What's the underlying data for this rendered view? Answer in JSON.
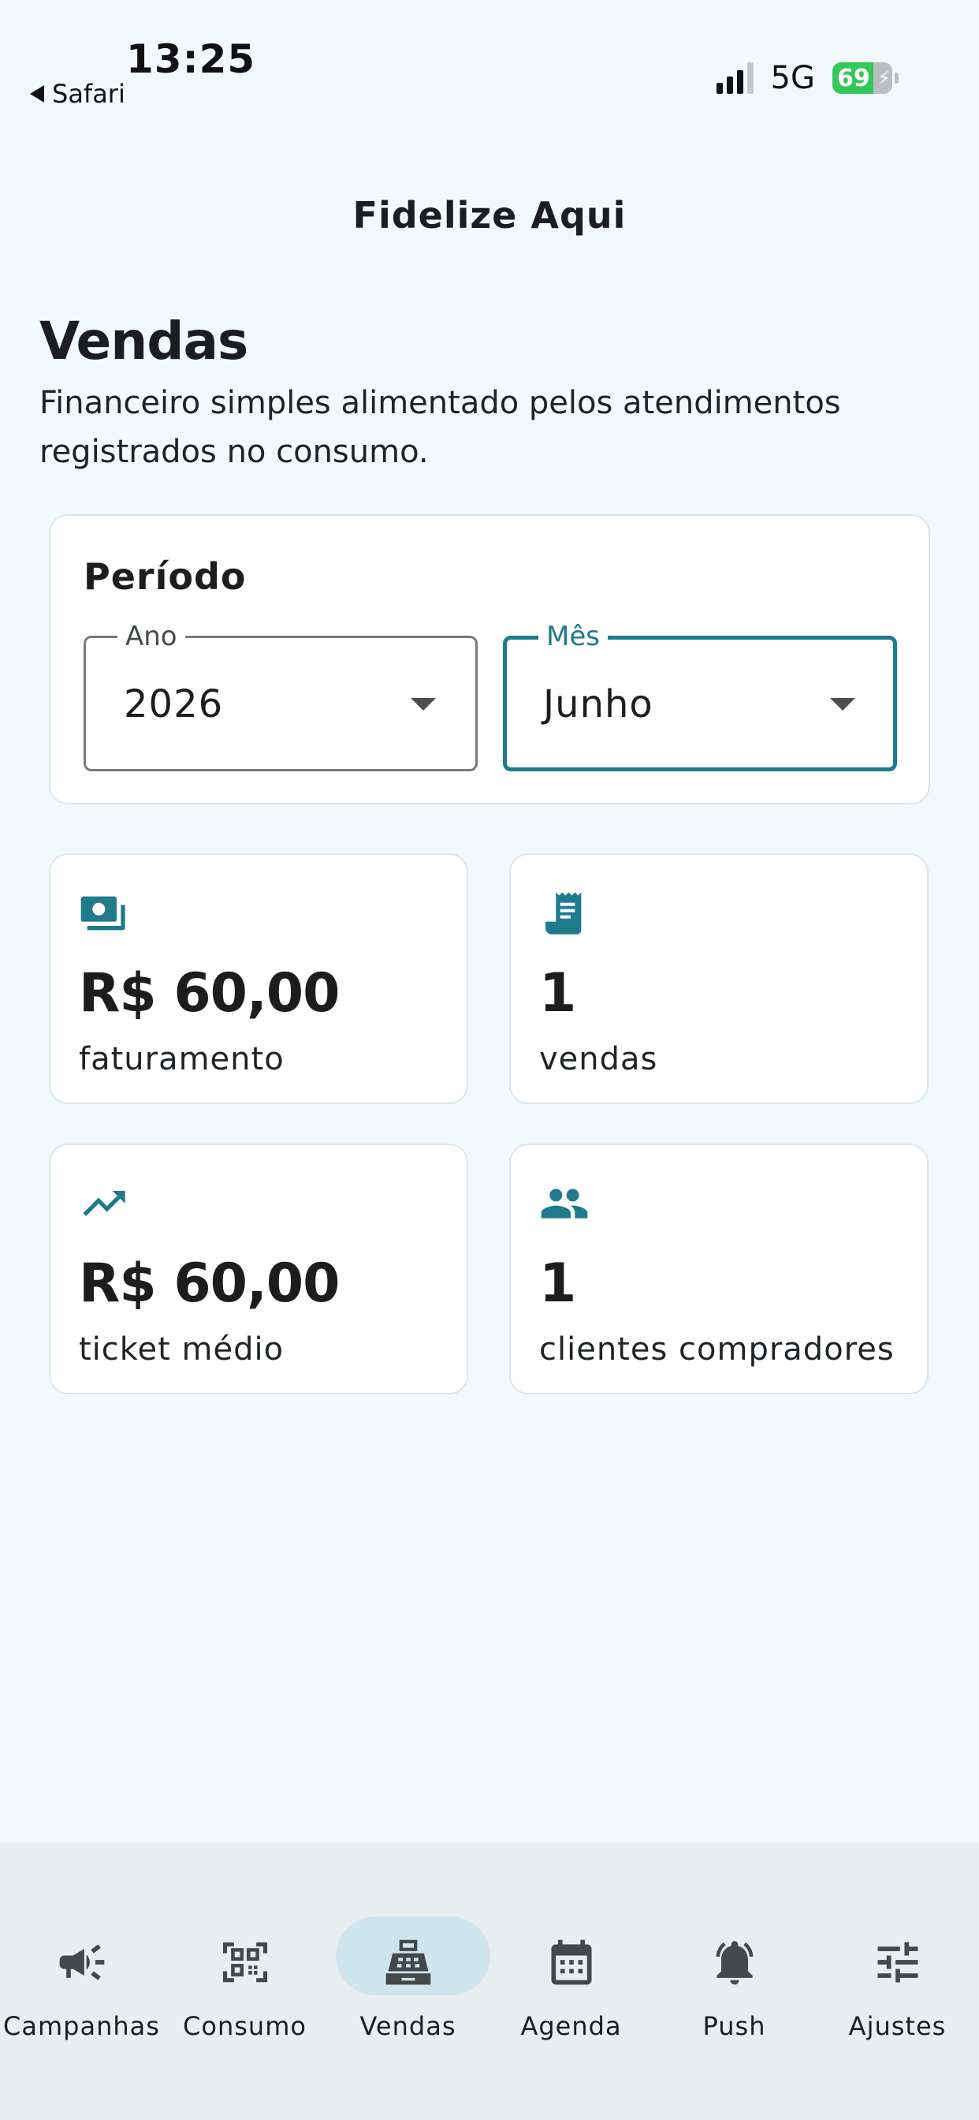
{
  "status_bar": {
    "time": "13:25",
    "back_app": "Safari",
    "network": "5G",
    "battery": "69"
  },
  "header": {
    "app_title": "Fidelize Aqui"
  },
  "page": {
    "title": "Vendas",
    "description": "Financeiro simples alimentado pelos atendimentos registrados no consumo."
  },
  "period": {
    "title": "Período",
    "year_label": "Ano",
    "year_value": "2026",
    "month_label": "Mês",
    "month_value": "Junho"
  },
  "stats": [
    {
      "icon": "cash-icon",
      "value": "R$ 60,00",
      "label": "faturamento"
    },
    {
      "icon": "receipt-icon",
      "value": "1",
      "label": "vendas"
    },
    {
      "icon": "trending-up-icon",
      "value": "R$ 60,00",
      "label": "ticket médio"
    },
    {
      "icon": "people-icon",
      "value": "1",
      "label": "clientes compradores"
    }
  ],
  "nav": {
    "active": "Vendas",
    "items": [
      {
        "label": "Campanhas",
        "icon": "megaphone-icon"
      },
      {
        "label": "Consumo",
        "icon": "qr-scan-icon"
      },
      {
        "label": "Vendas",
        "icon": "cash-register-icon"
      },
      {
        "label": "Agenda",
        "icon": "calendar-icon"
      },
      {
        "label": "Push",
        "icon": "bell-icon"
      },
      {
        "label": "Ajustes",
        "icon": "sliders-icon"
      }
    ]
  },
  "colors": {
    "accent": "#1f7a8c",
    "background": "#f2f9fc",
    "nav_background": "#e8edf0",
    "nav_active_pill": "#cfe6ee"
  }
}
